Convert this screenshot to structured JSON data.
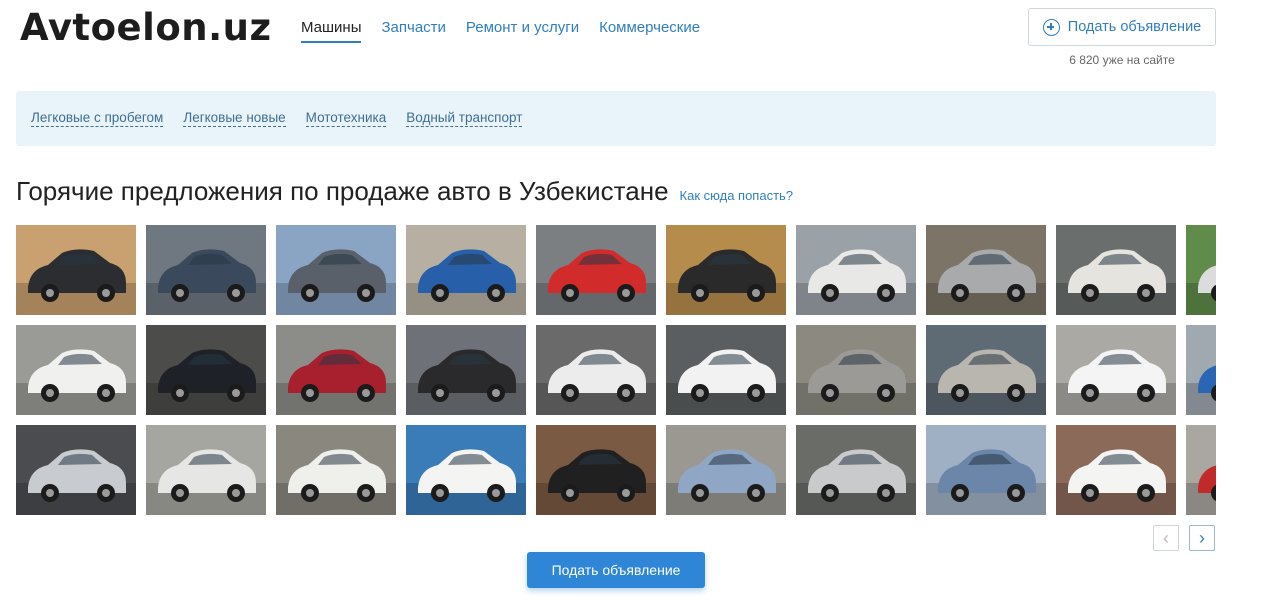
{
  "site": {
    "logo": "Avtoelon.uz"
  },
  "main_nav": [
    {
      "label": "Машины",
      "active": true
    },
    {
      "label": "Запчасти",
      "active": false
    },
    {
      "label": "Ремонт и услуги",
      "active": false
    },
    {
      "label": "Коммерческие",
      "active": false
    }
  ],
  "header": {
    "post_button_label": "Подать объявление",
    "online_text": "6 820 уже на сайте"
  },
  "subnav": [
    {
      "label": "Легковые с пробегом"
    },
    {
      "label": "Легковые новые"
    },
    {
      "label": "Мототехника"
    },
    {
      "label": "Водный транспорт"
    }
  ],
  "hot_offers": {
    "title": "Горячие предложения по продаже авто в Узбекистане",
    "help_link": "Как сюда попасть?"
  },
  "gallery": {
    "rows": [
      [
        {
          "car": "#2b2d30",
          "bg": "#c9a070"
        },
        {
          "car": "#3a4a5c",
          "bg": "#6f7780"
        },
        {
          "car": "#59606a",
          "bg": "#8aa4c4"
        },
        {
          "car": "#2760a8",
          "bg": "#b7b0a2"
        },
        {
          "car": "#d22b2b",
          "bg": "#7c7f82"
        },
        {
          "car": "#2a2a2a",
          "bg": "#b68c4c"
        },
        {
          "car": "#e8e8e6",
          "bg": "#9aa2a8"
        },
        {
          "car": "#a8aaac",
          "bg": "#7c7466"
        },
        {
          "car": "#e5e4de",
          "bg": "#6a6e6c"
        },
        {
          "car": "#dcdcdc",
          "bg": "#5f8c4a"
        }
      ],
      [
        {
          "car": "#f0f0ee",
          "bg": "#9a9a96"
        },
        {
          "car": "#1e2228",
          "bg": "#4c4c4a"
        },
        {
          "car": "#a81f2e",
          "bg": "#8c8c88"
        },
        {
          "car": "#2a2a2c",
          "bg": "#6e7278"
        },
        {
          "car": "#ececec",
          "bg": "#6a6a6a"
        },
        {
          "car": "#f2f2f2",
          "bg": "#5a5e60"
        },
        {
          "car": "#9c9a96",
          "bg": "#8c8a80"
        },
        {
          "car": "#b8b6ae",
          "bg": "#5e6a74"
        },
        {
          "car": "#f4f4f4",
          "bg": "#aaa9a4"
        },
        {
          "car": "#2a66b4",
          "bg": "#a0a8b0"
        }
      ],
      [
        {
          "car": "#c8ccd0",
          "bg": "#4a4c50"
        },
        {
          "car": "#e6e6e4",
          "bg": "#a6a6a0"
        },
        {
          "car": "#efefec",
          "bg": "#8a877e"
        },
        {
          "car": "#f4f4f2",
          "bg": "#3a7cb8"
        },
        {
          "car": "#202020",
          "bg": "#7a5a42"
        },
        {
          "car": "#8fa6c4",
          "bg": "#9a9890"
        },
        {
          "car": "#c8cacc",
          "bg": "#6a6c68"
        },
        {
          "car": "#6b86a8",
          "bg": "#9fb0c4"
        },
        {
          "car": "#f4f4f2",
          "bg": "#8c6a5a"
        },
        {
          "car": "#c02a2a",
          "bg": "#aaa6a0"
        }
      ]
    ]
  },
  "pager": {
    "prev_icon": "chevron-left-icon",
    "next_icon": "chevron-right-icon"
  },
  "footer_cta": {
    "label": "Подать объявление"
  },
  "colors": {
    "accent": "#2f86d6",
    "link": "#2f7fbf",
    "subnav_bg": "#e9f3fa"
  }
}
